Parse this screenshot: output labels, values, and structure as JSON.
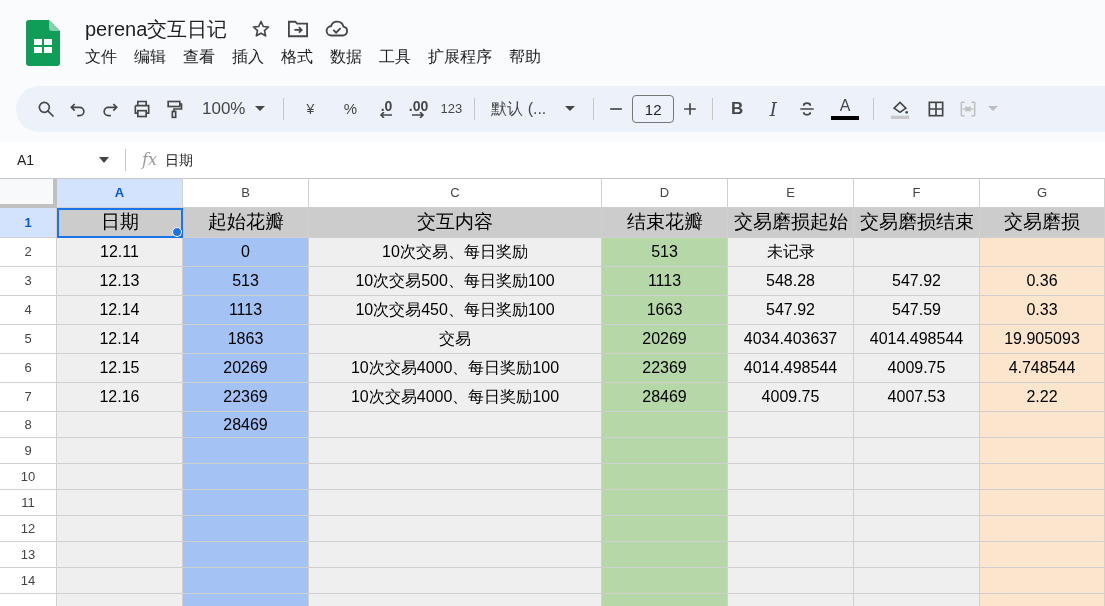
{
  "document": {
    "title": "perena交互日记"
  },
  "menu": [
    {
      "label": "文件"
    },
    {
      "label": "编辑"
    },
    {
      "label": "查看"
    },
    {
      "label": "插入"
    },
    {
      "label": "格式"
    },
    {
      "label": "数据"
    },
    {
      "label": "工具"
    },
    {
      "label": "扩展程序"
    },
    {
      "label": "帮助"
    }
  ],
  "toolbar": {
    "zoom": "100%",
    "currency": "¥",
    "percent": "%",
    "decrease_decimals": ".0",
    "increase_decimals": ".00",
    "number_format": "123",
    "font": "默认 (...",
    "font_size": "12",
    "bold": "B",
    "italic": "I",
    "text_color": "A",
    "merge_disabled": true
  },
  "formula_bar": {
    "cell_reference": "A1",
    "fx": "fx",
    "content": "日期"
  },
  "columns": [
    {
      "letter": "A",
      "selected": true,
      "color": "#efefef"
    },
    {
      "letter": "B",
      "selected": false,
      "color": "#a4c2f4"
    },
    {
      "letter": "C",
      "selected": false,
      "color": "#efefef"
    },
    {
      "letter": "D",
      "selected": false,
      "color": "#b6d7a8"
    },
    {
      "letter": "E",
      "selected": false,
      "color": "#efefef"
    },
    {
      "letter": "F",
      "selected": false,
      "color": "#efefef"
    },
    {
      "letter": "G",
      "selected": false,
      "color": "#fce5cd"
    }
  ],
  "rows": [
    {
      "number": "1",
      "kind": "header",
      "selected": true,
      "cells": [
        "日期",
        "起始花瓣",
        "交互内容",
        "结束花瓣",
        "交易磨损起始",
        "交易磨损结束",
        "交易磨损"
      ]
    },
    {
      "number": "2",
      "kind": "data",
      "selected": false,
      "cells": [
        "12.11",
        "0",
        "10次交易、每日奖励",
        "513",
        "未记录",
        "",
        ""
      ]
    },
    {
      "number": "3",
      "kind": "data",
      "selected": false,
      "cells": [
        "12.13",
        "513",
        "10次交易500、每日奖励100",
        "1113",
        "548.28",
        "547.92",
        "0.36"
      ]
    },
    {
      "number": "4",
      "kind": "data",
      "selected": false,
      "cells": [
        "12.14",
        "1113",
        "10次交易450、每日奖励100",
        "1663",
        "547.92",
        "547.59",
        "0.33"
      ]
    },
    {
      "number": "5",
      "kind": "data",
      "selected": false,
      "cells": [
        "12.14",
        "1863",
        "交易",
        "20269",
        "4034.403637",
        "4014.498544",
        "19.905093"
      ]
    },
    {
      "number": "6",
      "kind": "data",
      "selected": false,
      "cells": [
        "12.15",
        "20269",
        "10次交易4000、每日奖励100",
        "22369",
        "4014.498544",
        "4009.75",
        "4.748544"
      ]
    },
    {
      "number": "7",
      "kind": "data",
      "selected": false,
      "cells": [
        "12.16",
        "22369",
        "10次交易4000、每日奖励100",
        "28469",
        "4009.75",
        "4007.53",
        "2.22"
      ]
    },
    {
      "number": "8",
      "kind": "blank",
      "selected": false,
      "cells": [
        "",
        "28469",
        "",
        "",
        "",
        "",
        ""
      ]
    },
    {
      "number": "9",
      "kind": "blank",
      "selected": false,
      "cells": [
        "",
        "",
        "",
        "",
        "",
        "",
        ""
      ]
    },
    {
      "number": "10",
      "kind": "blank",
      "selected": false,
      "cells": [
        "",
        "",
        "",
        "",
        "",
        "",
        ""
      ]
    },
    {
      "number": "11",
      "kind": "blank",
      "selected": false,
      "cells": [
        "",
        "",
        "",
        "",
        "",
        "",
        ""
      ]
    },
    {
      "number": "12",
      "kind": "blank",
      "selected": false,
      "cells": [
        "",
        "",
        "",
        "",
        "",
        "",
        ""
      ]
    },
    {
      "number": "13",
      "kind": "blank",
      "selected": false,
      "cells": [
        "",
        "",
        "",
        "",
        "",
        "",
        ""
      ]
    },
    {
      "number": "14",
      "kind": "blank",
      "selected": false,
      "cells": [
        "",
        "",
        "",
        "",
        "",
        "",
        ""
      ]
    }
  ]
}
